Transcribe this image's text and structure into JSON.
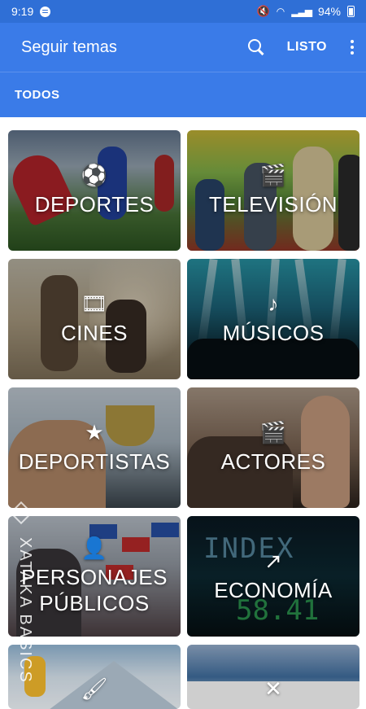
{
  "status_bar": {
    "time": "9:19",
    "battery": "94%",
    "icons": [
      "spotify-icon",
      "mute-icon",
      "wifi-icon",
      "signal-icon",
      "battery-icon"
    ]
  },
  "app_bar": {
    "title": "Seguir temas",
    "done_label": "LISTO",
    "icons": [
      "search-icon",
      "more-vert-icon"
    ],
    "color": "#3a7be8"
  },
  "tabs": {
    "active": "TODOS"
  },
  "topics": [
    {
      "label": "DEPORTES",
      "icon": "soccer-ball-icon",
      "glyph": "⚽"
    },
    {
      "label": "TELEVISIÓN",
      "icon": "clapperboard-icon",
      "glyph": "🎬"
    },
    {
      "label": "CINES",
      "icon": "film-strip-icon",
      "glyph": "🎞"
    },
    {
      "label": "MÚSICOS",
      "icon": "music-note-icon",
      "glyph": "♪"
    },
    {
      "label": "DEPORTISTAS",
      "icon": "star-icon",
      "glyph": "★"
    },
    {
      "label": "ACTORES",
      "icon": "clapperboard-icon",
      "glyph": "🎬"
    },
    {
      "label": "PERSONAJES PÚBLICOS",
      "icon": "person-icon",
      "glyph": "👤"
    },
    {
      "label": "ECONOMÍA",
      "icon": "trending-up-icon",
      "glyph": "↗"
    },
    {
      "label": "",
      "icon": "brush-icon",
      "glyph": "🖌"
    },
    {
      "label": "",
      "icon": "cutlery-icon",
      "glyph": "✕"
    }
  ],
  "watermark": "XATAKA BASICS"
}
